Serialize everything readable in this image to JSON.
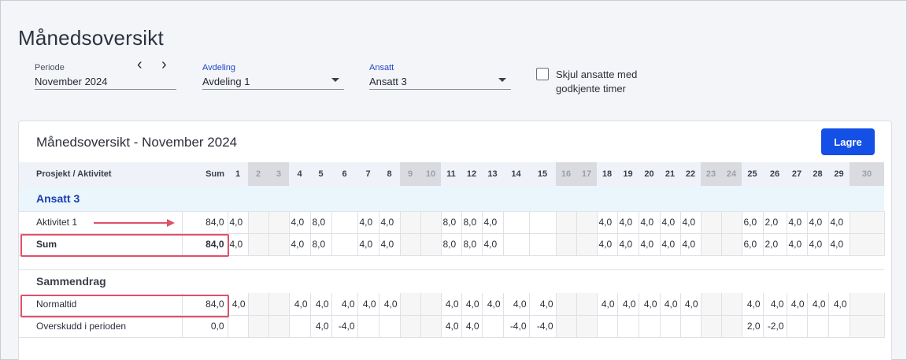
{
  "page": {
    "title": "Månedsoversikt"
  },
  "filters": {
    "periode_label": "Periode",
    "periode_value": "November 2024",
    "prev_icon": "‹",
    "next_icon": "›",
    "avdeling_label": "Avdeling",
    "avdeling_value": "Avdeling 1",
    "ansatt_label": "Ansatt",
    "ansatt_value": "Ansatt 3",
    "skjul_label": "Skjul ansatte med godkjente timer",
    "skjul_checked": false
  },
  "card": {
    "title": "Månedsoversikt - November 2024",
    "save_label": "Lagre"
  },
  "table": {
    "header_first": "Prosjekt / Aktivitet",
    "header_sum": "Sum",
    "days": [
      "1",
      "2",
      "3",
      "4",
      "5",
      "6",
      "7",
      "8",
      "9",
      "10",
      "11",
      "12",
      "13",
      "14",
      "15",
      "16",
      "17",
      "18",
      "19",
      "20",
      "21",
      "22",
      "23",
      "24",
      "25",
      "26",
      "27",
      "28",
      "29",
      "30"
    ],
    "weekend_days": [
      "2",
      "3",
      "9",
      "10",
      "16",
      "17",
      "23",
      "24",
      "30"
    ],
    "group_name": "Ansatt 3",
    "rows": [
      {
        "name": "Aktivitet 1",
        "sum": "84,0",
        "values": [
          "4,0",
          "",
          "",
          "4,0",
          "8,0",
          "",
          "4,0",
          "4,0",
          "",
          "",
          "8,0",
          "8,0",
          "4,0",
          "",
          "",
          "",
          "",
          "4,0",
          "4,0",
          "4,0",
          "4,0",
          "4,0",
          "",
          "",
          "6,0",
          "2,0",
          "4,0",
          "4,0",
          "4,0",
          ""
        ]
      },
      {
        "name": "Sum",
        "sum": "84,0",
        "values": [
          "4,0",
          "",
          "",
          "4,0",
          "8,0",
          "",
          "4,0",
          "4,0",
          "",
          "",
          "8,0",
          "8,0",
          "4,0",
          "",
          "",
          "",
          "",
          "4,0",
          "4,0",
          "4,0",
          "4,0",
          "4,0",
          "",
          "",
          "6,0",
          "2,0",
          "4,0",
          "4,0",
          "4,0",
          ""
        ]
      }
    ],
    "summary_title": "Sammendrag",
    "summary_rows": [
      {
        "name": "Normaltid",
        "sum": "84,0",
        "values": [
          "4,0",
          "",
          "",
          "4,0",
          "4,0",
          "4,0",
          "4,0",
          "4,0",
          "",
          "",
          "4,0",
          "4,0",
          "4,0",
          "4,0",
          "4,0",
          "",
          "",
          "4,0",
          "4,0",
          "4,0",
          "4,0",
          "4,0",
          "",
          "",
          "4,0",
          "4,0",
          "4,0",
          "4,0",
          "4,0",
          ""
        ]
      },
      {
        "name": "Overskudd i perioden",
        "sum": "0,0",
        "values": [
          "",
          "",
          "",
          "",
          "4,0",
          "-4,0",
          "",
          "",
          "",
          "",
          "4,0",
          "4,0",
          "",
          "-4,0",
          "-4,0",
          "",
          "",
          "",
          "",
          "",
          "",
          "",
          "",
          "",
          "2,0",
          "-2,0",
          "",
          "",
          "",
          ""
        ]
      }
    ]
  },
  "colors": {
    "accent": "#1450e6",
    "highlight": "#e0506a",
    "group_bg": "#eaf6fb",
    "weekend_header": "#d9dbe0"
  }
}
